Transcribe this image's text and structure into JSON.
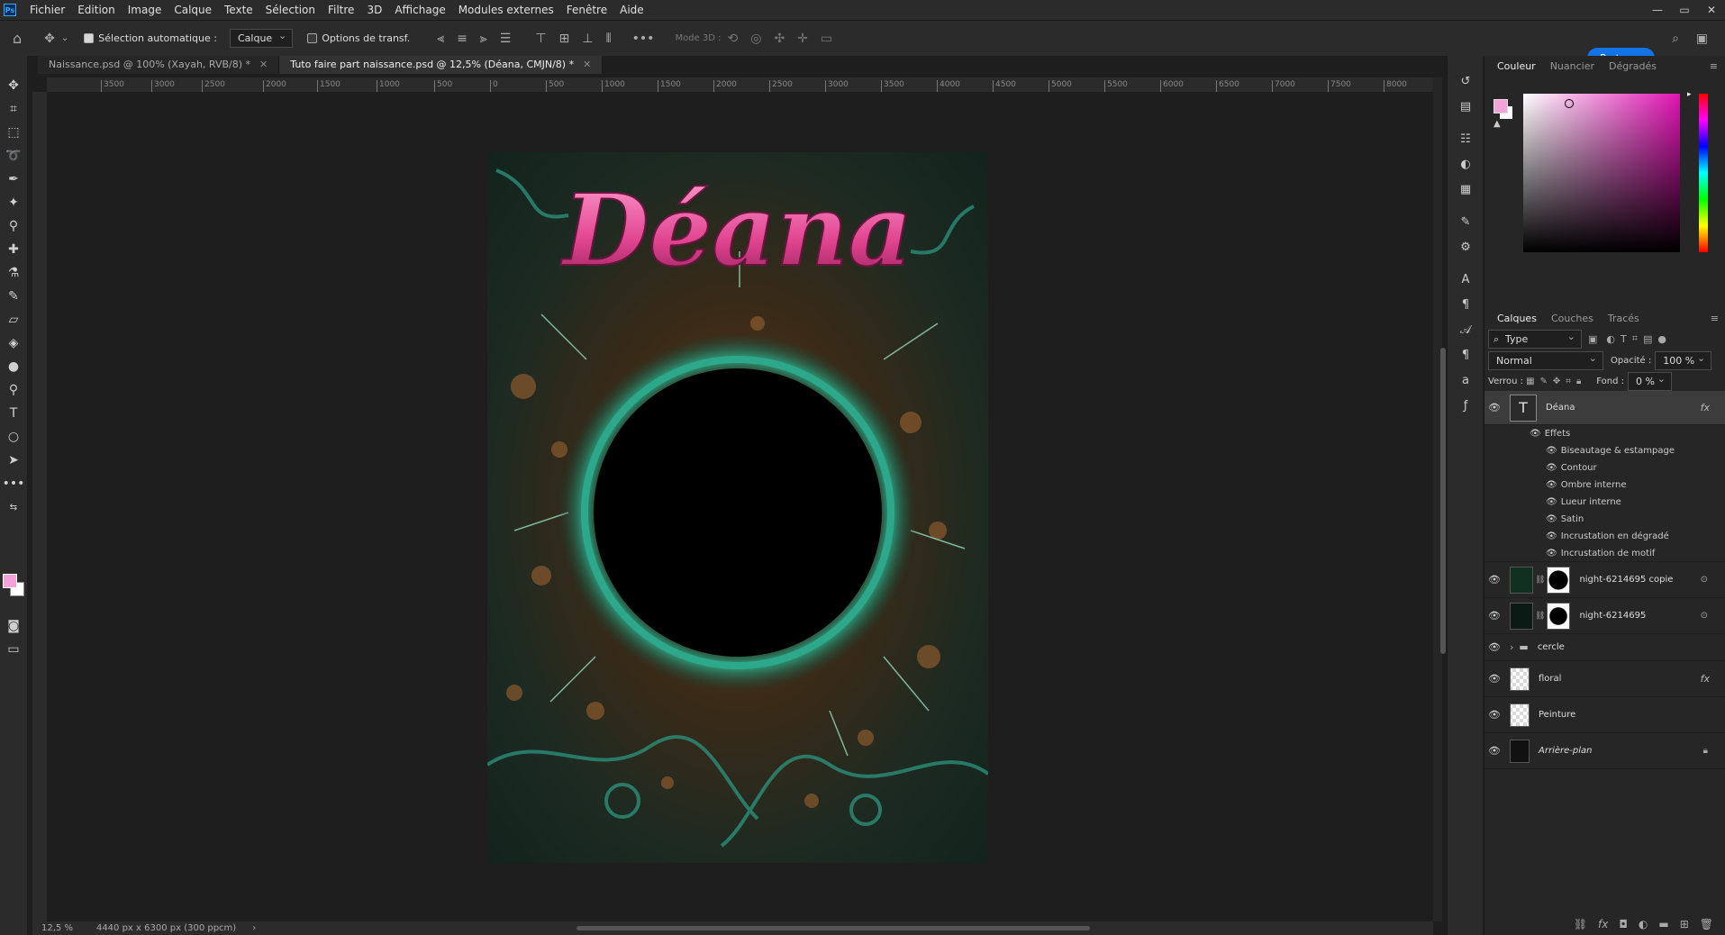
{
  "menu": {
    "logo": "Ps",
    "items": [
      "Fichier",
      "Edition",
      "Image",
      "Calque",
      "Texte",
      "Sélection",
      "Filtre",
      "3D",
      "Affichage",
      "Modules externes",
      "Fenêtre",
      "Aide"
    ]
  },
  "window_controls": [
    "—",
    "▭",
    "✕"
  ],
  "options": {
    "auto_select_label": "Sélection automatique :",
    "auto_select_target": "Calque",
    "transform_label": "Options de transf.",
    "mode3d_label": "Mode 3D :",
    "share_label": "Partager"
  },
  "tabs": [
    {
      "label": "Naissance.psd @ 100% (Xayah, RVB/8) *"
    },
    {
      "label": "Tuto faire part naissance.psd @ 12,5% (Déana, CMJN/8) *"
    }
  ],
  "ruler_ticks": [
    "3500",
    "3000",
    "2500",
    "2000",
    "1500",
    "1000",
    "500",
    "0",
    "500",
    "1000",
    "1500",
    "2000",
    "2500",
    "3000",
    "3500",
    "4000",
    "4500",
    "5000",
    "5500",
    "6000",
    "6500",
    "7000",
    "7500",
    "8000"
  ],
  "document": {
    "title_text": "Déana"
  },
  "status": {
    "zoom": "12,5 %",
    "doc_size": "4440 px x 6300 px (300 ppcm)"
  },
  "color_panel": {
    "tabs": [
      "Couleur",
      "Nuancier",
      "Dégradés"
    ],
    "foreground": "#f2a3d8",
    "background": "#ffffff"
  },
  "layers_panel": {
    "tabs": [
      "Calques",
      "Couches",
      "Tracés"
    ],
    "filter_label": "Type",
    "blend_mode": "Normal",
    "opacity_label": "Opacité :",
    "opacity_value": "100 %",
    "lock_label": "Verrou :",
    "fill_label": "Fond :",
    "fill_value": "0 %",
    "effects_label": "Effets",
    "layers": [
      {
        "name": "Déana",
        "kind": "text",
        "fx": "fx"
      },
      {
        "name": "night-6214695 copie",
        "kind": "image"
      },
      {
        "name": "night-6214695",
        "kind": "image"
      },
      {
        "name": "cercle",
        "kind": "group"
      },
      {
        "name": "floral",
        "kind": "checker",
        "fx": "fx"
      },
      {
        "name": "Peinture",
        "kind": "checker"
      },
      {
        "name": "Arrière-plan",
        "kind": "background"
      }
    ],
    "effects": [
      "Biseautage & estampage",
      "Contour",
      "Ombre interne",
      "Lueur interne",
      "Satin",
      "Incrustation en dégradé",
      "Incrustation de motif"
    ]
  }
}
